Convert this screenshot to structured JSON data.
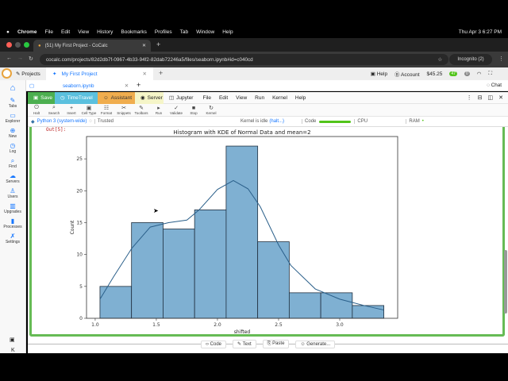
{
  "mac_menubar": {
    "app": "Chrome",
    "items": [
      "File",
      "Edit",
      "View",
      "History",
      "Bookmarks",
      "Profiles",
      "Tab",
      "Window",
      "Help"
    ],
    "clock": "Thu Apr 3  6:27 PM"
  },
  "browser": {
    "tab_title": "(51) My First Project - CoCalc",
    "url": "cocalc.com/projects/82d2db7f-0967-4b33-94f2-82dab72246a5/files/seaborn.ipynb#id=c040cd",
    "incognito": "Incognito (2)"
  },
  "cocalc": {
    "projects": "Projects",
    "project_tab": "My First Project",
    "help": "Help",
    "account": "Account",
    "balance": "$45.25",
    "notif_count": "47",
    "badge": "0",
    "file_tab": "seaborn.ipynb",
    "chat": "Chat"
  },
  "sidebar": [
    {
      "icon": "⌂",
      "label": ""
    },
    {
      "icon": "✎",
      "label": "Tabs"
    },
    {
      "icon": "▭",
      "label": "Explorer"
    },
    {
      "icon": "⊕",
      "label": "New"
    },
    {
      "icon": "◷",
      "label": "Log"
    },
    {
      "icon": "⌕",
      "label": "Find"
    },
    {
      "icon": "☁",
      "label": "Servers"
    },
    {
      "icon": "♙",
      "label": "Users"
    },
    {
      "icon": "▥",
      "label": "Upgrades"
    },
    {
      "icon": "▮",
      "label": "Processes"
    },
    {
      "icon": "✗",
      "label": "Settings"
    }
  ],
  "toolbar": {
    "save": "Save",
    "timetravel": "TimeTravel",
    "assistant": "Assistant",
    "server": "Server",
    "jupyter": "Jupyter",
    "menus": [
      "File",
      "Edit",
      "View",
      "Run",
      "Kernel",
      "Help"
    ]
  },
  "icon_bar": [
    {
      "i": "⏻",
      "l": "Halt"
    },
    {
      "i": "⌕",
      "l": "Search"
    },
    {
      "i": "+",
      "l": "Insert"
    },
    {
      "i": "▣",
      "l": "Cell Type"
    },
    {
      "i": "☷",
      "l": "Format"
    },
    {
      "i": "✂",
      "l": "Snippets"
    },
    {
      "i": "✎",
      "l": "Toolbars"
    },
    {
      "i": "▸",
      "l": "Run"
    },
    {
      "i": "✓",
      "l": "Validate"
    },
    {
      "i": "■",
      "l": "Stop"
    },
    {
      "i": "↻",
      "l": "Kernel"
    }
  ],
  "kernel": {
    "name": "Python 3 (system-wide)",
    "trusted": "Trusted",
    "status": "Kernel is idle",
    "halt": "(halt...)",
    "code": "Code",
    "cpu": "CPU",
    "ram": "RAM"
  },
  "cell": {
    "out_label": "Out[5]:"
  },
  "insert_bar": {
    "code": "Code",
    "text": "Text",
    "paste": "Paste",
    "generate": "Generate..."
  },
  "colors": {
    "bar": "#7fb0d2",
    "edge": "#1f2f3f",
    "kde": "#2a5f8a",
    "save": "#4caf50",
    "timetravel": "#5bc0de",
    "assistant": "#f0ad4e",
    "server": "#f5f5c8"
  },
  "chart_data": {
    "type": "bar",
    "title": "Histogram with KDE of Normal Data and mean=2",
    "xlabel": "shifted",
    "ylabel": "Count",
    "bin_edges": [
      1.039,
      1.297,
      1.555,
      1.813,
      2.071,
      2.329,
      2.587,
      2.845,
      3.103,
      3.361
    ],
    "values": [
      5,
      15,
      14,
      17,
      27,
      12,
      4,
      4,
      2
    ],
    "kde": {
      "x": [
        1.039,
        1.15,
        1.3,
        1.45,
        1.6,
        1.75,
        1.85,
        2.0,
        2.13,
        2.25,
        2.35,
        2.5,
        2.6,
        2.8,
        3.0,
        3.2,
        3.361
      ],
      "y": [
        3,
        6.5,
        11,
        14.3,
        15,
        15.4,
        17,
        20.2,
        21.6,
        20.3,
        17.5,
        11.5,
        8.3,
        4.6,
        3.0,
        2.0,
        1.3
      ]
    },
    "xlim": [
      0.929,
      3.474
    ],
    "ylim": [
      0,
      28.5
    ],
    "xticks": [
      1.0,
      1.5,
      2.0,
      2.5,
      3.0
    ],
    "xtick_labels": [
      "1.0",
      "1.5",
      "2.0",
      "2.5",
      "3.0"
    ],
    "yticks": [
      0,
      5,
      10,
      15,
      20,
      25
    ],
    "ytick_labels": [
      "0",
      "5",
      "10",
      "15",
      "20",
      "25"
    ]
  }
}
